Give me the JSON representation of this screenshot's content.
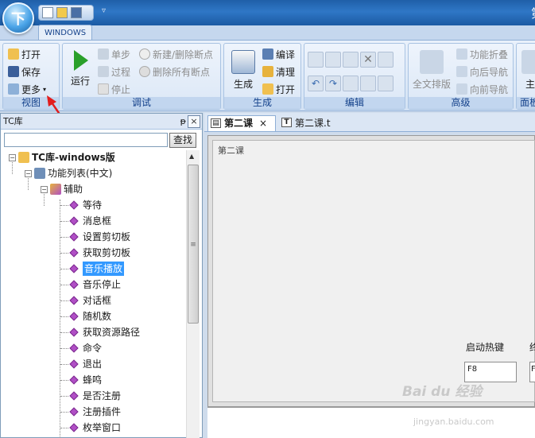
{
  "title_bar": {
    "title_partial": "第"
  },
  "ribbon": {
    "tab_label": "WINDOWS",
    "groups": {
      "view": {
        "label": "视图",
        "open": "打开",
        "save": "保存",
        "more": "更多"
      },
      "debug": {
        "label": "调试",
        "run": "运行",
        "step": "单步",
        "pass": "过程",
        "stop": "停止",
        "toggle_bp": "新建/删除断点",
        "clear_bp": "删除所有断点"
      },
      "build": {
        "label": "生成",
        "build": "生成",
        "compile": "编译",
        "clean": "清理",
        "open": "打开"
      },
      "edit": {
        "label": "编辑"
      },
      "advanced": {
        "label": "高级",
        "format_all": "全文排版",
        "fold": "功能折叠",
        "nav_back": "向后导航",
        "nav_fwd": "向前导航"
      },
      "panel": {
        "label": "面板",
        "main_partial": "主"
      }
    }
  },
  "left_panel": {
    "title": "TC库",
    "pin": "ᵽ",
    "close": "×",
    "search_placeholder": "",
    "search_button": "查找",
    "tree": {
      "root": "TC库-windows版",
      "child": "功能列表(中文)",
      "group": "辅助",
      "items": [
        "等待",
        "消息框",
        "设置剪切板",
        "获取剪切板",
        "音乐播放",
        "音乐停止",
        "对话框",
        "随机数",
        "获取资源路径",
        "命令",
        "退出",
        "蜂鸣",
        "是否注册",
        "注册插件",
        "枚举窗口"
      ],
      "selected": "音乐播放"
    }
  },
  "doc_tabs": [
    {
      "label": "第二课",
      "active": true,
      "close": "×"
    },
    {
      "label": "第二课.t",
      "active": false
    }
  ],
  "form": {
    "title": "第二课",
    "hotkey_label": "启动热键",
    "hotkey_value": "F8",
    "second_label": "终",
    "second_value": "F"
  },
  "watermark": {
    "line1": "Bai du 经验",
    "line2": "jingyan.baidu.com"
  },
  "colors": {
    "accent": "#3399ff",
    "ribbon_group_label": "#15428b",
    "annotation_arrow": "#e21d1d"
  }
}
